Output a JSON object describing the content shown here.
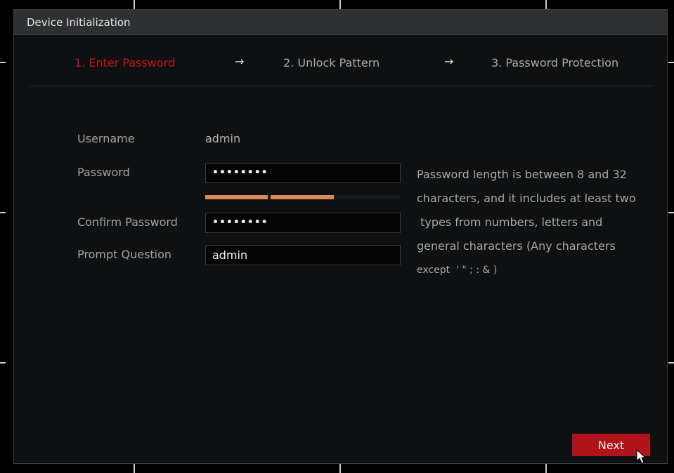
{
  "dialog": {
    "title": "Device Initialization"
  },
  "steps": [
    {
      "label": "1.  Enter Password",
      "active": true
    },
    {
      "label": "2.  Unlock Pattern",
      "active": false
    },
    {
      "label": "3.  Password Protection",
      "active": false
    }
  ],
  "step_arrow": "→",
  "form": {
    "username_label": "Username",
    "username_value": "admin",
    "password_label": "Password",
    "password_value": "••••••••",
    "password_strength_segments_filled": 2,
    "password_strength_segments_total": 3,
    "confirm_label": "Confirm Password",
    "confirm_value": "••••••••",
    "prompt_label": "Prompt Question",
    "prompt_value": "admin"
  },
  "hint_lines": [
    "Password length is between 8 and 32",
    "characters, and it includes at least two",
    " types from numbers, letters and",
    "general characters (Any characters",
    "except  ' \" ; : & )"
  ],
  "buttons": {
    "next_label": "Next"
  },
  "colors": {
    "accent_red": "#c2151b",
    "button_red": "#b0141a",
    "strength_orange": "#d98a58",
    "title_bar": "#2e3032",
    "panel_bg": "#0f1011"
  },
  "icons": {
    "cursor": "mouse-pointer-icon",
    "arrow": "right-arrow-icon"
  }
}
